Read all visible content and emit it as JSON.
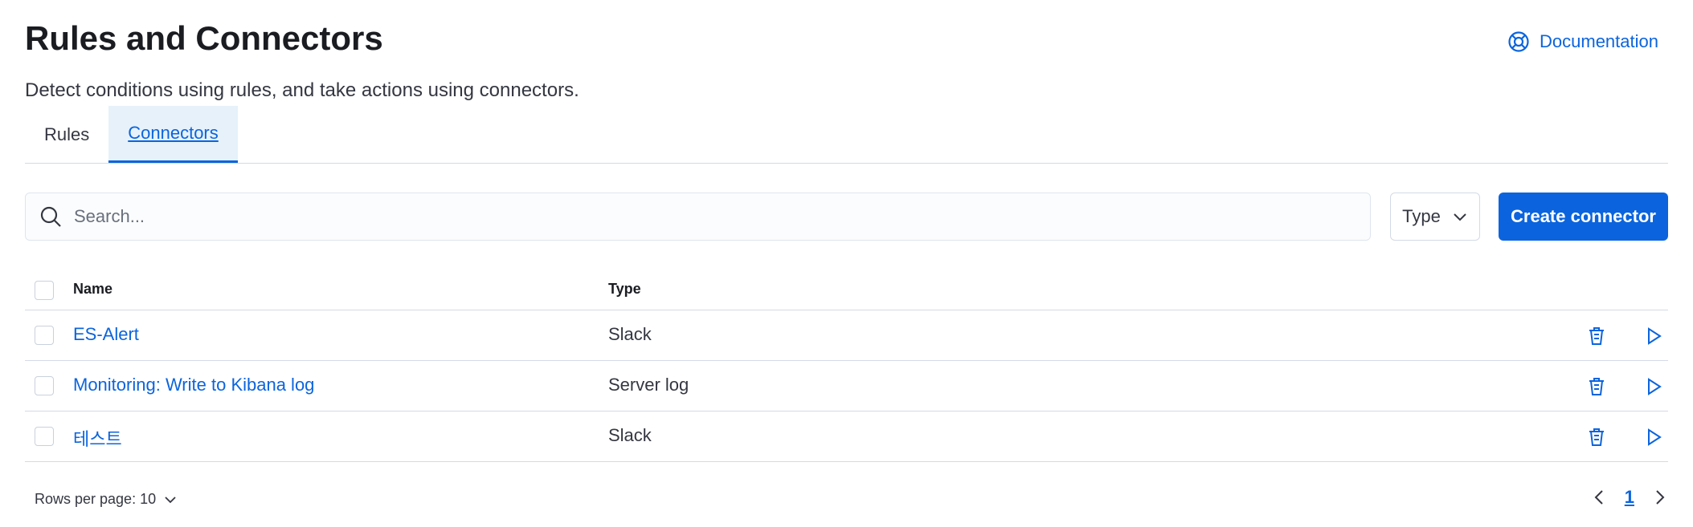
{
  "header": {
    "title": "Rules and Connectors",
    "subtitle": "Detect conditions using rules, and take actions using connectors.",
    "documentation_label": "Documentation"
  },
  "tabs": [
    {
      "label": "Rules",
      "active": false
    },
    {
      "label": "Connectors",
      "active": true
    }
  ],
  "toolbar": {
    "search_placeholder": "Search...",
    "type_filter_label": "Type",
    "create_button_label": "Create connector"
  },
  "table": {
    "columns": [
      "Name",
      "Type"
    ],
    "rows": [
      {
        "name": "ES-Alert",
        "type": "Slack"
      },
      {
        "name": "Monitoring: Write to Kibana log",
        "type": "Server log"
      },
      {
        "name": "테스트",
        "type": "Slack"
      }
    ]
  },
  "footer": {
    "rows_per_page_label": "Rows per page: 10",
    "current_page": "1"
  },
  "colors": {
    "accent": "#0b64dd",
    "active_tab_bg": "#e6f1fa"
  }
}
